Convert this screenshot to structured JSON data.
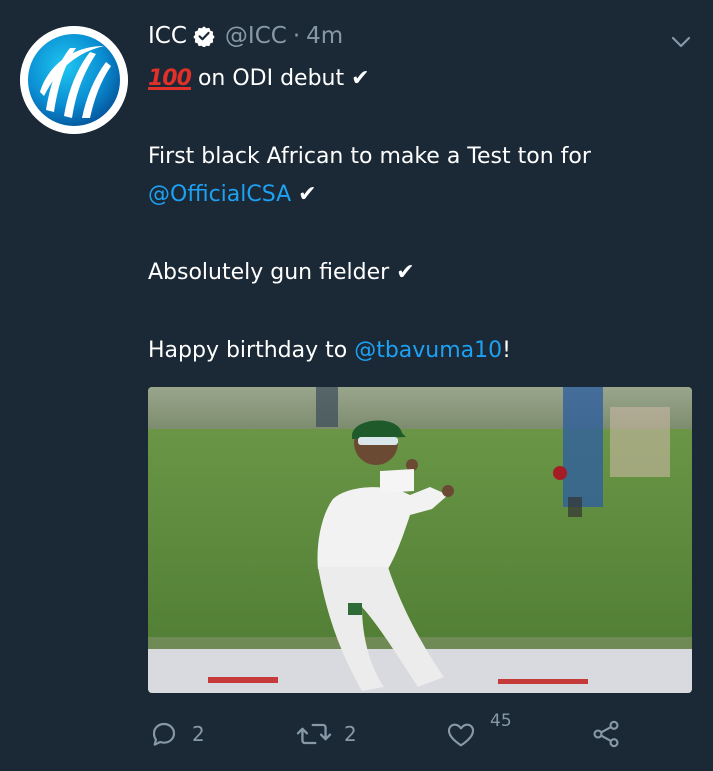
{
  "tweet": {
    "author_name": "ICC",
    "author_handle": "@ICC",
    "separator": "·",
    "time": "4m",
    "emoji_100": "100",
    "lines": {
      "l1_text": "on ODI debut",
      "l2_text": "First black African to make a Test ton for",
      "l3_mention": "@OfficialCSA",
      "l4_text": "Absolutely gun fielder",
      "l5_text": "Happy birthday to",
      "l5_mention": "@tbavuma10",
      "l5_tail": "!"
    },
    "checkmark": "✔",
    "counts": {
      "replies": "2",
      "retweets": "2",
      "likes": "45"
    }
  },
  "icons": {
    "verified": "verified-badge-icon",
    "caret": "chevron-down-icon",
    "reply": "reply-icon",
    "retweet": "retweet-icon",
    "like": "heart-icon",
    "share": "share-icon"
  },
  "colors": {
    "background": "#1b2836",
    "text": "#ffffff",
    "muted": "#8899a6",
    "link": "#1da1f2"
  }
}
